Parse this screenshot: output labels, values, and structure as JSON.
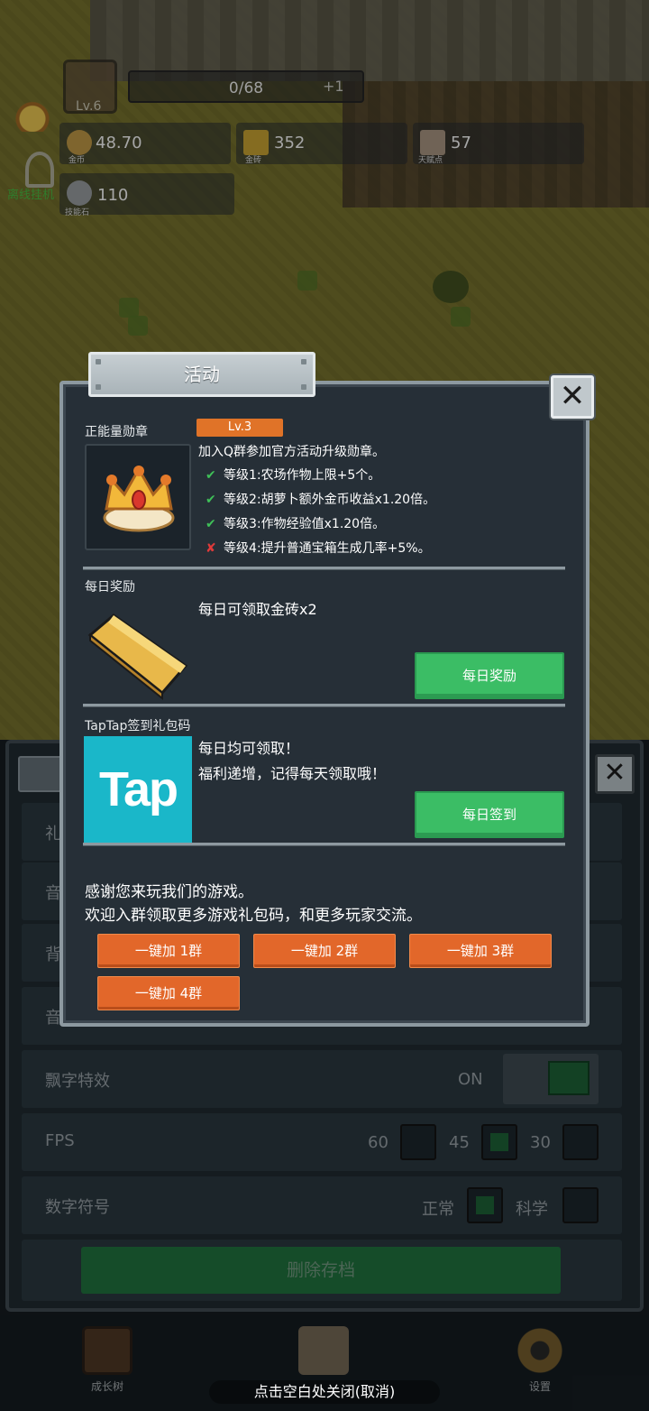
{
  "hud": {
    "level": "Lv.6",
    "exp": "0/68",
    "exp_plus": "+1",
    "coins": "48.70",
    "coins_caption": "金币",
    "gold_bricks": "352",
    "gold_bricks_caption": "金砖",
    "talent": "57",
    "talent_caption": "天赋点",
    "skill_stone": "110",
    "skill_stone_caption": "技能石",
    "idle_label": "离线挂机"
  },
  "settings": {
    "rows": [
      {
        "label": "礼"
      },
      {
        "label": "音"
      },
      {
        "label": "背"
      },
      {
        "label": "音"
      },
      {
        "label": "飘字特效",
        "value": "ON"
      },
      {
        "label": "FPS",
        "options": [
          "60",
          "45",
          "30"
        ],
        "selected": "45"
      },
      {
        "label": "数字符号",
        "options": [
          "正常",
          "科学"
        ],
        "selected": "正常"
      }
    ],
    "delete_label": "删除存档"
  },
  "dialog": {
    "title": "活动",
    "medal": {
      "section_title": "正能量勋章",
      "level": "Lv.3",
      "description": "加入Q群参加官方活动升级勋章。",
      "perks": [
        {
          "text": "等级1:农场作物上限+5个。",
          "unlocked": true
        },
        {
          "text": "等级2:胡萝卜额外金币收益x1.20倍。",
          "unlocked": true
        },
        {
          "text": "等级3:作物经验值x1.20倍。",
          "unlocked": true
        },
        {
          "text": "等级4:提升普通宝箱生成几率+5%。",
          "unlocked": false
        }
      ]
    },
    "daily": {
      "section_title": "每日奖励",
      "text": "每日可领取金砖x2",
      "button": "每日奖励"
    },
    "taptap": {
      "section_title": "TapTap签到礼包码",
      "logo_text": "Tap",
      "line1": "每日均可领取！",
      "line2": "福利递增，记得每天领取哦！",
      "button": "每日签到"
    },
    "community": {
      "line1": "感谢您来玩我们的游戏。",
      "line2": "欢迎入群领取更多游戏礼包码，和更多玩家交流。",
      "buttons": [
        "一键加 1群",
        "一键加 2群",
        "一键加 3群",
        "一键加 4群"
      ]
    }
  },
  "bottom_nav": {
    "items": [
      {
        "label": "成长树",
        "icon": "book-icon"
      },
      {
        "label": "",
        "icon": "map-icon"
      },
      {
        "label": "设置",
        "icon": "gear-icon"
      }
    ],
    "close_hint": "点击空白处关闭(取消)"
  },
  "colors": {
    "accent_green": "#3bbd65",
    "accent_orange": "#e2672a",
    "tap_cyan": "#1ab7c9",
    "panel_bg": "#262f37"
  }
}
